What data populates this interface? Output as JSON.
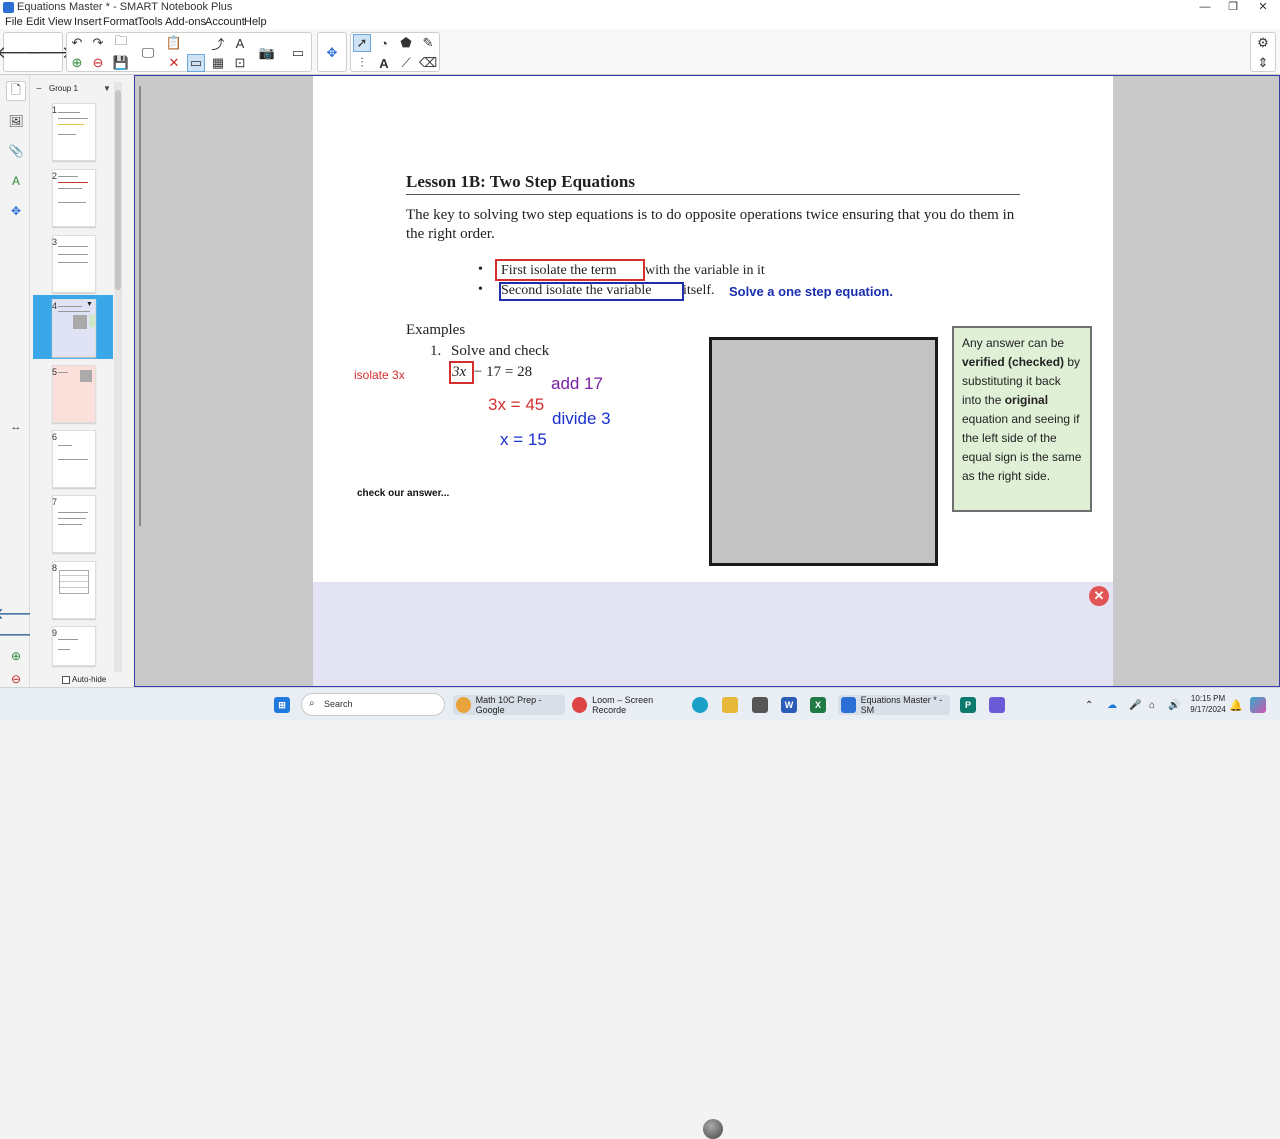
{
  "window": {
    "title": "Equations Master * - SMART Notebook Plus",
    "minimize": "—",
    "restore": "❐",
    "close": "✕"
  },
  "menu": [
    "File",
    "Edit",
    "View",
    "Insert",
    "Format",
    "Tools",
    "Add-ons",
    "Account",
    "Help"
  ],
  "sorter": {
    "group_label": "Group 1",
    "pages": [
      "1",
      "2",
      "3",
      "4",
      "5",
      "6",
      "7",
      "8",
      "9"
    ],
    "selected_page": "4",
    "auto_hide_label": "Auto-hide"
  },
  "slide": {
    "title": "Lesson 1B: Two Step Equations",
    "intro": "The key to solving two step equations is to do opposite operations twice ensuring that you do them in the right order.",
    "bullet1_boxed": "First isolate the term",
    "bullet1_rest": "with the variable in it",
    "bullet2_boxed": "Second isolate the variable",
    "bullet2_rest": "itself.",
    "bullet2_note": "Solve a one step equation.",
    "examples_heading": "Examples",
    "example_num": "1.",
    "example_text": "Solve and check",
    "equation_term": "3x",
    "equation_rest": "− 17 = 28",
    "note_box_html_parts": {
      "p1": "Any answer can be ",
      "b1": "verified (checked)",
      "p2": " by substituting it back into the ",
      "b2": "original",
      "p3": " equation and seeing if the left side of the equal sign is the same as the right side."
    }
  },
  "handwriting": {
    "isolate": "isolate 3x",
    "add": "add 17",
    "step2": "3x = 45",
    "divide": "divide 3",
    "step3": "x = 15",
    "check": "check our answer..."
  },
  "colors": {
    "red_box": "#d32f2f",
    "blue_box": "#1f2fa8",
    "note_blue": "#1a2fb0",
    "purple": "#7b1fa2",
    "red_ink": "#d32f2f",
    "blue_ink": "#1a2fd0",
    "note_bg": "#dff0d6"
  },
  "taskbar": {
    "search_placeholder": "Search",
    "app1": "Math 10C Prep - Google",
    "app2": "Loom – Screen Recorde",
    "app3": "Equations Master * - SM",
    "time": "10:15 PM",
    "date": "9/17/2024"
  }
}
